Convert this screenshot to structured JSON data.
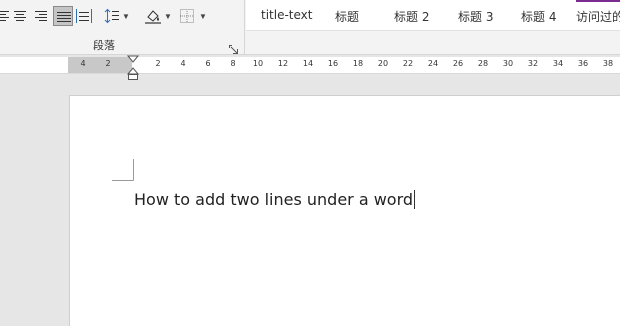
{
  "ribbon": {
    "paragraph_group_label": "段落",
    "styles": [
      "title-text",
      "标题",
      "标题 2",
      "标题 3",
      "标题 4",
      "访问过的…"
    ],
    "accent_color": "#7b2b8f",
    "icons": [
      "align-left-icon",
      "align-center-icon",
      "align-right-icon",
      "justify-icon",
      "distributed-icon",
      "line-spacing-icon",
      "shading-icon",
      "borders-icon",
      "dialog-launcher-icon"
    ]
  },
  "ruler": {
    "left_ticks": [
      "4",
      "2"
    ],
    "right_ticks": [
      "2",
      "4",
      "6",
      "8",
      "10",
      "12",
      "14",
      "16",
      "18",
      "20",
      "22",
      "24",
      "26",
      "28",
      "30",
      "32",
      "34",
      "36",
      "38"
    ]
  },
  "document": {
    "text": "How to add two lines under a word"
  }
}
